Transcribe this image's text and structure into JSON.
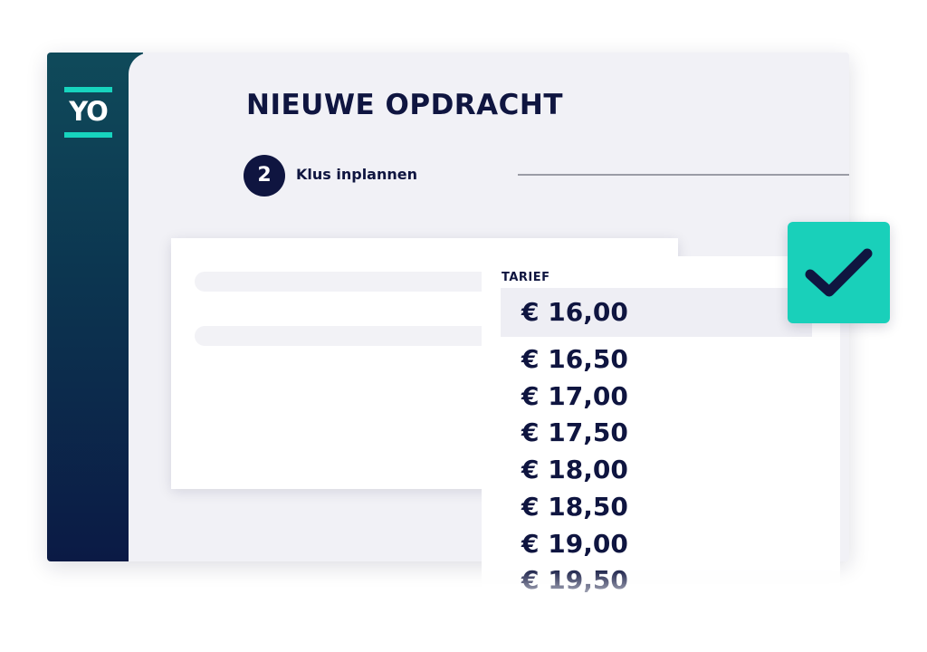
{
  "brand": {
    "logo_text": "YO",
    "accent_color": "#17d4be",
    "navy_color": "#0f1540"
  },
  "header": {
    "title": "NIEUWE OPDRACHT"
  },
  "step": {
    "number": "2",
    "label": "Klus inplannen"
  },
  "tariff_dropdown": {
    "label": "TARIEF",
    "selected_index": 0,
    "options": [
      "€ 16,00",
      "€ 16,50",
      "€ 17,00",
      "€ 17,50",
      "€ 18,00",
      "€ 18,50",
      "€ 19,00",
      "€ 19,50"
    ]
  },
  "confirm": {
    "icon": "checkmark-icon",
    "color": "#19d0ba"
  }
}
